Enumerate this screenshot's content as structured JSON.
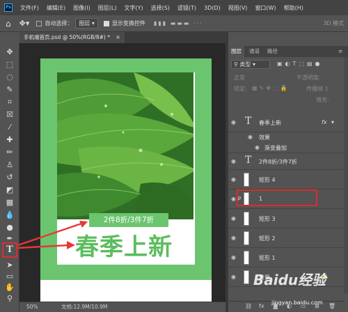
{
  "app": {
    "logo_text": "Ps"
  },
  "menu": [
    "文件(F)",
    "编辑(E)",
    "图像(I)",
    "图层(L)",
    "文字(Y)",
    "选择(S)",
    "滤镜(T)",
    "3D(D)",
    "视图(V)",
    "窗口(W)",
    "帮助(H)"
  ],
  "options": {
    "auto_select_label": "自动选择：",
    "auto_select_value": "图层",
    "transform_label": "显示变换控件",
    "mode_3d": "3D 模式"
  },
  "document": {
    "tab_title": "手机端首页.psd @ 50%(RGB/8#) *",
    "close": "×"
  },
  "poster": {
    "tag_text": "2件8折/3件7折",
    "headline": "春季上新"
  },
  "status": {
    "zoom": "50%",
    "doc_info": "文档:12.9M/10.9M"
  },
  "layers_panel": {
    "tabs": [
      "图层",
      "通道",
      "路径"
    ],
    "filter_label": "类型",
    "blend_mode": "正常",
    "opacity_label": "不透明度:",
    "lock_label": "锁定:",
    "fill_label": "填充:",
    "propagate_label": "传播帧 1",
    "layers": [
      {
        "name": "春季上新",
        "kind": "text",
        "fx": "fx"
      },
      {
        "name": "效果",
        "kind": "effect"
      },
      {
        "name": "渐变叠加",
        "kind": "effect-item"
      },
      {
        "name": "2件8折/3件7折",
        "kind": "text"
      },
      {
        "name": "矩形 4",
        "kind": "shape"
      },
      {
        "name": "1",
        "kind": "shape"
      },
      {
        "name": "矩形 3",
        "kind": "shape"
      },
      {
        "name": "矩形 2",
        "kind": "shape"
      },
      {
        "name": "矩形 1",
        "kind": "shape"
      },
      {
        "name": "背景",
        "kind": "background"
      }
    ]
  },
  "watermark": {
    "brand": "Baidu经验",
    "url": "jingyan.baidu.com"
  },
  "colors": {
    "poster_green": "#6bc56f",
    "headline_green": "#5cbd5e",
    "highlight_red": "#e02b2b",
    "arrow_red": "#e53935"
  }
}
